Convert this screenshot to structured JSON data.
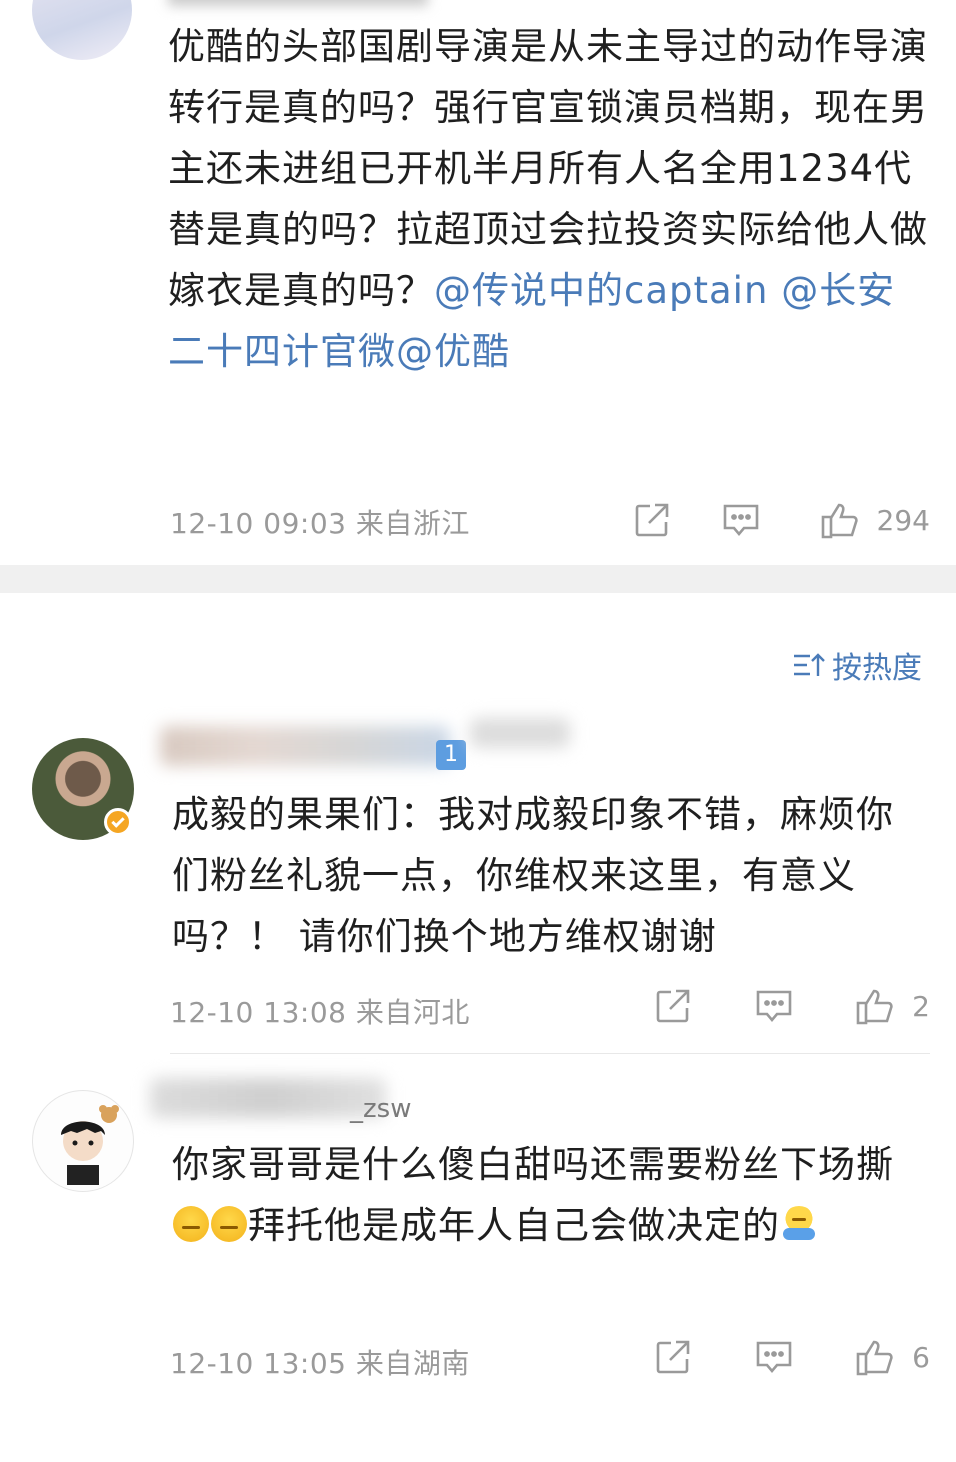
{
  "post": {
    "text_plain": "优酷的头部国剧导演是从未主导过的动作导演转行是真的吗？强行官宣锁演员档期，现在男主还未进组已开机半月所有人名全用1234代替是真的吗？拉超顶过会拉投资实际给他人做嫁衣是真的吗？",
    "mentions": [
      "@传说中的captain",
      "@长安二十四计官微",
      "@优酷"
    ],
    "time": "12-10 09:03",
    "location": "来自浙江",
    "likes": "294"
  },
  "sort": {
    "label": "按热度"
  },
  "comments": [
    {
      "text": "成毅的果果们：我对成毅印象不错，麻烦你们粉丝礼貌一点，你维权来这里，有意义吗？！ 请你们换个地方维权谢谢",
      "time": "12-10 13:08",
      "location": "来自河北",
      "likes": "2",
      "badge": "1"
    },
    {
      "name_tail": "_zsw",
      "text_a": "你家哥哥是什么傻白甜吗还需要粉丝下场撕",
      "text_b": "拜托他是成年人自己会做决定的",
      "time": "12-10 13:05",
      "location": "来自湖南",
      "likes": "6"
    }
  ],
  "icons": {
    "share": "share-icon",
    "comment": "comment-icon",
    "like": "like-icon",
    "sort": "sort-icon",
    "verified": "verified-icon"
  },
  "colors": {
    "link": "#4a7bb8",
    "meta": "#9a9a9a",
    "divider": "#f0f0f0",
    "verified": "#f5a623"
  }
}
